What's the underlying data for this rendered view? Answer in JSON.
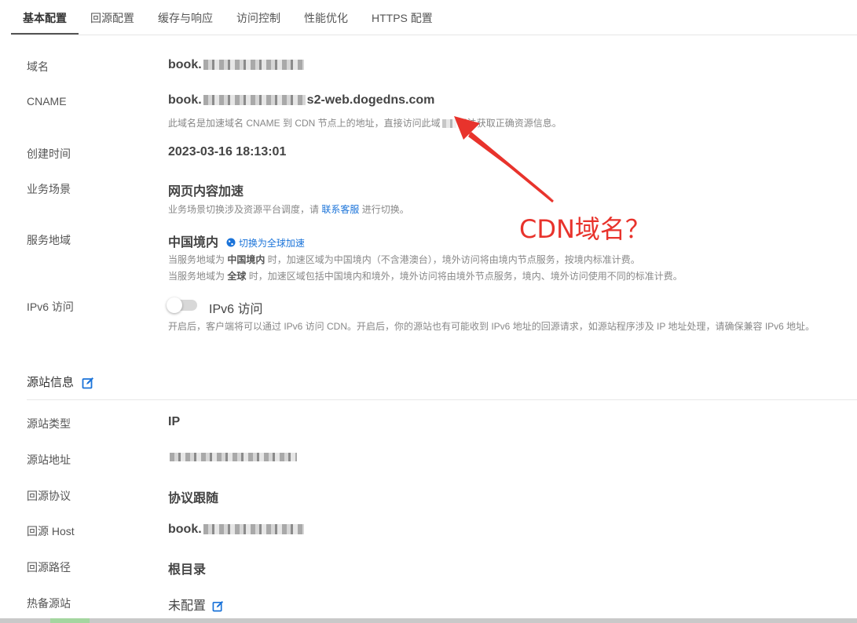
{
  "tabs": [
    {
      "label": "基本配置"
    },
    {
      "label": "回源配置"
    },
    {
      "label": "缓存与响应"
    },
    {
      "label": "访问控制"
    },
    {
      "label": "性能优化"
    },
    {
      "label": "HTTPS 配置"
    }
  ],
  "basic": {
    "domain": {
      "label": "域名",
      "value_prefix": "book."
    },
    "cname": {
      "label": "CNAME",
      "value_prefix": "book.",
      "value_suffix": "s2-web.dogedns.com",
      "desc_a": "此域名是加速域名 CNAME 到 CDN 节点上的地址，直接访问此域",
      "desc_b": "无法获取正确资源信息。"
    },
    "created": {
      "label": "创建时间",
      "value": "2023-03-16 18:13:01"
    },
    "scene": {
      "label": "业务场景",
      "value": "网页内容加速",
      "desc_a": "业务场景切换涉及资源平台调度，请",
      "desc_link": "联系客服",
      "desc_b": "进行切换。"
    },
    "region": {
      "label": "服务地域",
      "value": "中国境内",
      "switch_link": "切换为全球加速",
      "desc1_a": "当服务地域为",
      "desc1_b": "中国境内",
      "desc1_c": "时，加速区域为中国境内（不含港澳台），境外访问将由境内节点服务，按境内标准计费。",
      "desc2_a": "当服务地域为",
      "desc2_b": "全球",
      "desc2_c": "时，加速区域包括中国境内和境外，境外访问将由境外节点服务，境内、境外访问使用不同的标准计费。"
    },
    "ipv6": {
      "label": "IPv6 访问",
      "toggle_label": "IPv6 访问",
      "enabled": false,
      "desc": "开启后，客户端将可以通过 IPv6 访问 CDN。开启后，你的源站也有可能收到 IPv6 地址的回源请求，如源站程序涉及 IP 地址处理，请确保兼容 IPv6 地址。"
    }
  },
  "origin": {
    "title": "源站信息",
    "type": {
      "label": "源站类型",
      "value": "IP"
    },
    "address": {
      "label": "源站地址"
    },
    "protocol": {
      "label": "回源协议",
      "value": "协议跟随"
    },
    "host": {
      "label": "回源 Host",
      "value_prefix": "book."
    },
    "path": {
      "label": "回源路径",
      "value": "根目录"
    },
    "backup": {
      "label": "热备源站",
      "value": "未配置"
    }
  },
  "annotation": {
    "text": "CDN域名？",
    "color": "#e8332c"
  },
  "colors": {
    "link": "#1a73d9",
    "edit_icon": "#1a73d9"
  }
}
